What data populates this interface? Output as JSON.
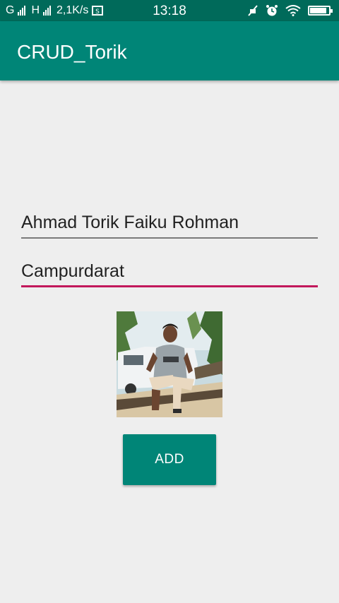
{
  "status_bar": {
    "carrier1": "G",
    "carrier2": "H",
    "speed": "2,1K/s",
    "time": "13:18",
    "icons": [
      "sim-icon",
      "mute-icon",
      "alarm-icon",
      "wifi-icon",
      "battery-icon"
    ],
    "battery_level": 0.9
  },
  "app_bar": {
    "title": "CRUD_Torik"
  },
  "form": {
    "name_value": "Ahmad Torik Faiku Rohman",
    "address_value": "Campurdarat",
    "photo_icon": "person-photo",
    "add_label": "ADD"
  },
  "colors": {
    "primary": "#008577",
    "primary_dark": "#006a5a",
    "accent": "#c2185b",
    "background": "#eeeeee"
  }
}
